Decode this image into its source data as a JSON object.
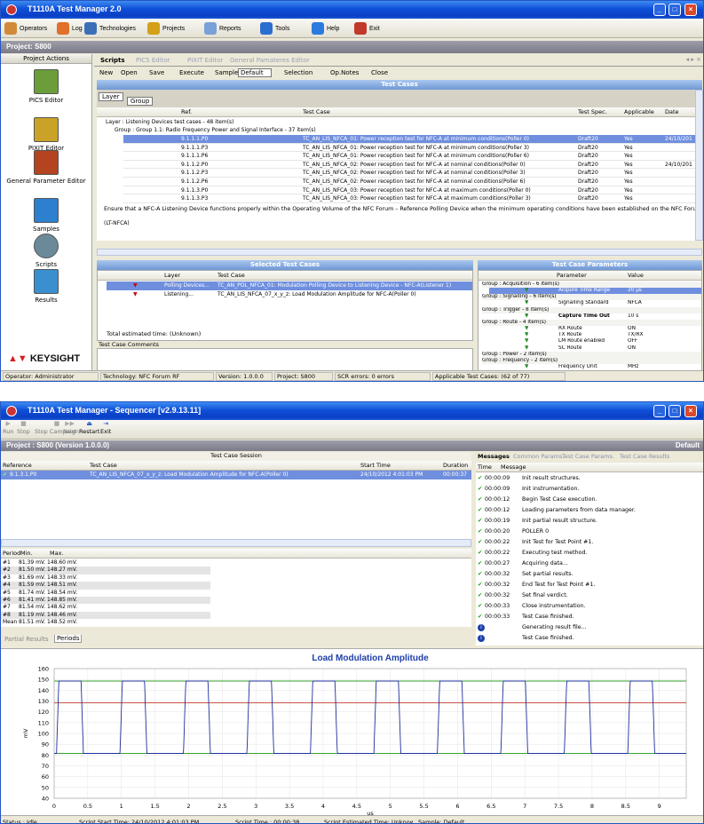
{
  "w1": {
    "title": "T1110A Test Manager 2.0",
    "menu": [
      {
        "label": "Operators",
        "icon": "operators-icon",
        "color": "#d08a3a"
      },
      {
        "label": "Log Off",
        "icon": "logoff-icon",
        "color": "#e0702a"
      },
      {
        "label": "Technologies",
        "icon": "technologies-icon",
        "color": "#3a6fb8"
      },
      {
        "label": "Projects",
        "icon": "projects-icon",
        "color": "#d4a017"
      },
      {
        "label": "Reports",
        "icon": "reports-icon",
        "color": "#7aa0d8"
      },
      {
        "label": "Tools",
        "icon": "tools-icon",
        "color": "#2a6ed0"
      },
      {
        "label": "Help",
        "icon": "help-icon",
        "color": "#2a7ae0"
      },
      {
        "label": "Exit",
        "icon": "exit-icon",
        "color": "#c0392b"
      }
    ],
    "project": "Project:  S800",
    "sidebar": {
      "header": "Project Actions",
      "items": [
        "PICS Editor",
        "PIXIT Editor",
        "General Parameter Editor",
        "Samples",
        "Scripts",
        "Results"
      ],
      "logo": "KEYSIGHT"
    },
    "tabs": [
      "Scripts",
      "PICS Editor",
      "PIXIT Editor",
      "General Pamateres Editor"
    ],
    "toolbar": {
      "new": "New",
      "open": "Open",
      "save": "Save",
      "execute": "Execute",
      "sample_label": "Sample",
      "sample_value": "Default",
      "selection": "Selection",
      "opnotes": "Op.Notes",
      "close": "Close"
    },
    "tc": {
      "header": "Test Cases",
      "groupby": [
        "Layer",
        "Group"
      ],
      "columns": [
        "Ref.",
        "Test Case",
        "Test Spec.",
        "Applicable",
        "Date"
      ],
      "layer_row": "Layer : Listening Devices test cases - 48 item(s)",
      "group_row": "Group : Group 1.1: Radio Frequency Power and Signal Interface - 37 item(s)",
      "rows": [
        [
          "9.1.1.1.P0",
          "TC_AN_LIS_NFCA_01: Power reception test for NFC-A at minimum conditions(Poller 0)",
          "Draft20",
          "Yes",
          "24/10/201"
        ],
        [
          "9.1.1.1.P3",
          "TC_AN_LIS_NFCA_01: Power reception test for NFC-A at minimum conditions(Poller 3)",
          "Draft20",
          "Yes",
          ""
        ],
        [
          "9.1.1.1.P6",
          "TC_AN_LIS_NFCA_01: Power reception test for NFC-A at minimum conditions(Poller 6)",
          "Draft20",
          "Yes",
          ""
        ],
        [
          "9.1.1.2.P0",
          "TC_AN_LIS_NFCA_02: Power reception test for NFC-A at nominal conditions(Poller 0)",
          "Draft20",
          "Yes",
          "24/10/201"
        ],
        [
          "9.1.1.2.P3",
          "TC_AN_LIS_NFCA_02: Power reception test for NFC-A at nominal conditions(Poller 3)",
          "Draft20",
          "Yes",
          ""
        ],
        [
          "9.1.1.2.P6",
          "TC_AN_LIS_NFCA_02: Power reception test for NFC-A at nominal conditions(Poller 6)",
          "Draft20",
          "Yes",
          ""
        ],
        [
          "9.1.1.3.P0",
          "TC_AN_LIS_NFCA_03: Power reception test for NFC-A at maximum conditions(Poller 0)",
          "Draft20",
          "Yes",
          ""
        ],
        [
          "9.1.1.3.P3",
          "TC_AN_LIS_NFCA_03: Power reception test for NFC-A at maximum conditions(Poller 3)",
          "Draft20",
          "Yes",
          ""
        ]
      ],
      "desc": "Ensure that a NFC-A Listening Device functions properly within the Operating Volume of the NFC Forum – Reference Polling Device when the minimum operating conditions have been established on the NFC Forum –",
      "desc2": "(LT-NFCA)"
    },
    "sel": {
      "header": "Selected Test Cases",
      "columns": [
        "Layer",
        "Test Case"
      ],
      "rows": [
        [
          "Polling Devices...",
          "TC_AN_POL_NFCA_01: Modulation Polling Device to Listening Device - NFC-A(Listener 1)"
        ],
        [
          "Listening...",
          "TC_AN_LIS_NFCA_07_x_y_z: Load Modulation Amplitude for NFC-A(Poller 0)"
        ]
      ],
      "total": "Total estimated time: (Unknown)",
      "comments": "Test Case Comments"
    },
    "params": {
      "header": "Test Case Parameters",
      "columns": [
        "Parameter",
        "Value"
      ],
      "rows": [
        {
          "g": "Group : Acquisition - 6 item(s)"
        },
        {
          "p": "Acquire Time Range",
          "v": "20 µs",
          "sel": true
        },
        {
          "g": "Group : Signalling - 6 item(s)"
        },
        {
          "p": "Signalling Standard",
          "v": "NFCA"
        },
        {
          "g": "Group : Trigger - 8 item(s)"
        },
        {
          "p": "Capture Time Out",
          "v": "10 s",
          "b": true
        },
        {
          "g": "Group : Route - 4 item(s)"
        },
        {
          "p": "RX Route",
          "v": "ON"
        },
        {
          "p": "TX Route",
          "v": "TX/RX"
        },
        {
          "p": "LM Route enabled",
          "v": "OFF"
        },
        {
          "p": "SC Route",
          "v": "ON"
        },
        {
          "g": "Group : Power - 2 item(s)"
        },
        {
          "g": "Group : Frequency - 2 item(s)"
        },
        {
          "p": "Frequency Unit",
          "v": "MHz"
        }
      ]
    },
    "status": [
      "Operator: Administrator",
      "Technology: NFC Forum RF",
      "Version: 1.0.0.0",
      "Project: S800",
      "SCR errors: 0 errors",
      "Applicable Test Cases: (62 of 77)"
    ]
  },
  "w2": {
    "title": "T1110A Test Manager - Sequencer [v2.9.13.11]",
    "tools": [
      "Run",
      "Stop",
      "Stop Campaign",
      "Next",
      "Restart",
      "Exit"
    ],
    "project": "Project :  S800 (Version 1.0.0.0)",
    "default_label": "Default",
    "session": {
      "header": "Test Case Session",
      "columns": [
        "Reference",
        "Test Case",
        "Start Time",
        "Duration"
      ],
      "row": [
        "9.1.3.1.P0",
        "TC_AN_LIS_NFCA_07_x_y_z: Load Modulation Amplitude for NFC-A(Poller 0)",
        "24/10/2012 4:01:03 PM",
        "00:00:37"
      ]
    },
    "periods": {
      "columns": [
        "Period",
        "Min.",
        "Max."
      ],
      "rows": [
        [
          "#1",
          "81.39 mV.",
          "148.60 mV."
        ],
        [
          "#2",
          "81.50 mV.",
          "148.27 mV."
        ],
        [
          "#3",
          "81.69 mV.",
          "148.33 mV."
        ],
        [
          "#4",
          "81.59 mV.",
          "148.51 mV."
        ],
        [
          "#5",
          "81.74 mV.",
          "148.54 mV."
        ],
        [
          "#6",
          "81.41 mV.",
          "148.85 mV."
        ],
        [
          "#7",
          "81.54 mV.",
          "148.62 mV."
        ],
        [
          "#8",
          "81.19 mV.",
          "148.46 mV."
        ],
        [
          "Mean",
          "81.51 mV.",
          "148.52 mV."
        ]
      ],
      "tabs": [
        "Partial Results",
        "Periods"
      ]
    },
    "msgtabs": [
      "Messages",
      "Common Params.",
      "Test Case Params.",
      "Test Case Results"
    ],
    "messages": {
      "columns": [
        "Time",
        "Message"
      ],
      "rows": [
        [
          "00:00:09",
          "Init result structures.",
          "c"
        ],
        [
          "00:00:09",
          "Init instrumentation.",
          "c"
        ],
        [
          "00:00:12",
          "Begin Test Case execution.",
          "c"
        ],
        [
          "00:00:12",
          "Loading parameters from data manager.",
          "c"
        ],
        [
          "00:00:19",
          "Init partial result structure.",
          "c"
        ],
        [
          "00:00:20",
          "POLLER 0",
          "c"
        ],
        [
          "00:00:22",
          "Init Test for Test Point #1.",
          "c"
        ],
        [
          "00:00:22",
          "Executing test method.",
          "c"
        ],
        [
          "00:00:27",
          "Acquiring data...",
          "c"
        ],
        [
          "00:00:32",
          "Set partial results.",
          "c"
        ],
        [
          "00:00:32",
          "End Test for Test Point #1.",
          "c"
        ],
        [
          "00:00:32",
          "Set final verdict.",
          "c"
        ],
        [
          "00:00:33",
          "Close instrumentation.",
          "c"
        ],
        [
          "00:00:33",
          "Test Case finished.",
          "c"
        ],
        [
          "",
          "Generating result file...",
          "i"
        ],
        [
          "",
          "Test Case finished.",
          "i"
        ]
      ]
    },
    "status": [
      "Status : Idle",
      "Script Start Time: 24/10/2012 4:01:03 PM",
      "Script Time : 00:00:38",
      "Script Estimated Time: Unknown",
      "Sample: Default"
    ]
  },
  "chart_data": {
    "type": "line",
    "title": "Load Modulation Amplitude",
    "xlabel": "us",
    "ylabel": "mV",
    "xlim": [
      0,
      9.4
    ],
    "ylim": [
      40,
      160
    ],
    "xticks": [
      0,
      0.5,
      1,
      1.5,
      2,
      2.5,
      3,
      3.5,
      4,
      4.5,
      5,
      5.5,
      6,
      6.5,
      7,
      7.5,
      8,
      8.5,
      9
    ],
    "yticks": [
      40,
      50,
      60,
      70,
      80,
      90,
      100,
      110,
      120,
      130,
      140,
      150,
      160
    ],
    "series": [
      {
        "color": "#1f2f9e",
        "period": 0.944,
        "high_start": 0.07,
        "high_end": 0.4,
        "high": 148.5,
        "low": 81.5,
        "x_start": 0.0,
        "x_end": 9.4
      }
    ],
    "hlines": [
      {
        "y": 148.5,
        "color": "#33a02c"
      },
      {
        "y": 128.3,
        "color": "#c0392b"
      },
      {
        "y": 81.5,
        "color": "#33a02c"
      }
    ]
  }
}
